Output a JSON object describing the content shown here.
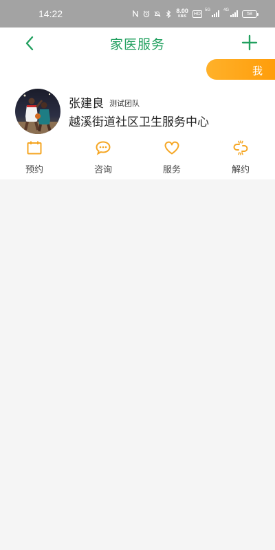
{
  "status_bar": {
    "time": "14:22",
    "net_speed_value": "8.00",
    "net_speed_unit": "KB/S",
    "hd_label": "HD",
    "network_1": "5G",
    "network_2": "4G",
    "battery": "58"
  },
  "header": {
    "title": "家医服务"
  },
  "card": {
    "me_label": "我",
    "doctor_name": "张建良",
    "team_tag": "测试团队",
    "center_name": "越溪街道社区卫生服务中心"
  },
  "actions": [
    {
      "label": "预约",
      "icon": "calendar-icon"
    },
    {
      "label": "咨询",
      "icon": "chat-bubble-icon"
    },
    {
      "label": "服务",
      "icon": "heart-icon"
    },
    {
      "label": "解约",
      "icon": "broken-link-icon"
    }
  ],
  "colors": {
    "accent_green": "#21a05f",
    "accent_orange": "#ffa315",
    "background": "#f5f5f5",
    "status_bar": "#a3a3a3"
  }
}
